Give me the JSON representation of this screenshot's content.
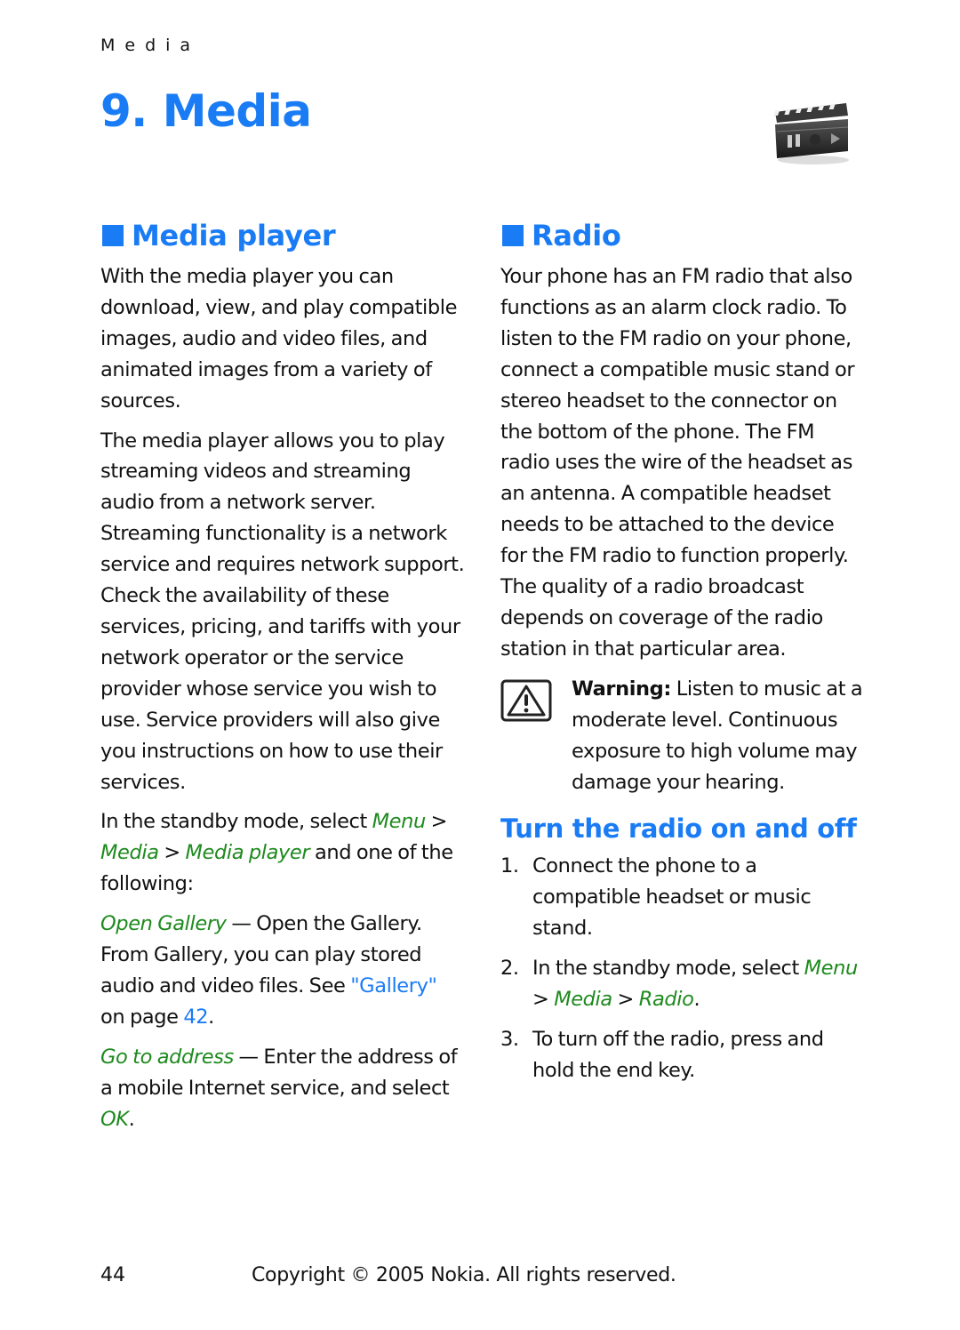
{
  "running_head": "Media",
  "chapter": {
    "title": "9. Media",
    "icon": "clapperboard-media-icon"
  },
  "colors": {
    "heading_blue": "#1a7cf5",
    "menu_green": "#1e8a1e",
    "text": "#111111"
  },
  "media_player": {
    "heading": "Media player",
    "para1": "With the media player you can download, view, and play compatible images, audio and video files, and animated images from a variety of sources.",
    "para2": "The media player allows you to play streaming videos and streaming audio from a network server. Streaming functionality is a network service and requires network support. Check the availability of these services, pricing, and tariffs with your network operator or the service provider whose service you wish to use. Service providers will also give you instructions on how to use their services.",
    "standby": {
      "prefix": "In the standby mode, select ",
      "menu1": "Menu",
      "sep1": " > ",
      "menu2": "Media",
      "sep2": " > ",
      "menu3": "Media player",
      "suffix": " and one of the following:"
    },
    "open_gallery": {
      "option": "Open Gallery",
      "text": " — Open the Gallery. From Gallery, you can play stored audio and video files. See ",
      "link": "\"Gallery\"",
      "mid": " on page ",
      "page": "42",
      "end": "."
    },
    "go_to_address": {
      "option": "Go to address",
      "text": " — Enter the address of a mobile Internet service, and select ",
      "ok": "OK",
      "end": "."
    }
  },
  "radio": {
    "heading": "Radio",
    "para": "Your phone has an FM radio that also functions as an alarm clock radio. To listen to the FM radio on your phone, connect a compatible music stand or stereo headset to the connector on the bottom of the phone. The FM radio uses the wire of the headset as an antenna. A compatible headset needs to be attached to the device for the FM radio to function properly. The quality of a radio broadcast depends on coverage of the radio station in that particular area.",
    "warning": {
      "icon": "warning-triangle-icon",
      "label": "Warning:",
      "text": " Listen to music at a moderate level. Continuous exposure to high volume may damage your hearing."
    },
    "subheading": "Turn the radio on and off",
    "steps": [
      {
        "num": "1.",
        "text": "Connect the phone to a compatible headset or music stand."
      },
      {
        "num": "2.",
        "prefix": "In the standby mode, select ",
        "menu1": "Menu",
        "sep1": " > ",
        "menu2": "Media",
        "sep2": " > ",
        "menu3": "Radio",
        "end": "."
      },
      {
        "num": "3.",
        "text": "To turn off the radio, press and hold the end key."
      }
    ]
  },
  "footer": {
    "page_number": "44",
    "copyright": "Copyright © 2005 Nokia. All rights reserved."
  }
}
